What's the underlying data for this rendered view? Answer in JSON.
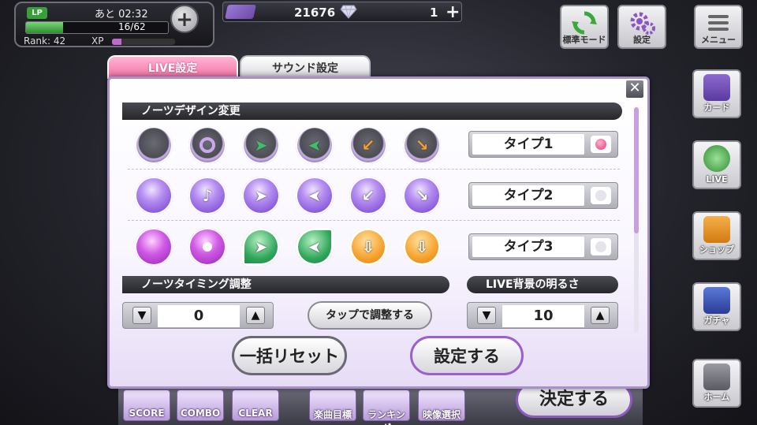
{
  "hud": {
    "lp_badge": "LP",
    "lp_time": "あと 02:32",
    "lp_count": "16/62",
    "lp_fraction": 0.26,
    "rank": "Rank: 42",
    "xp_label": "XP",
    "xp_fraction": 0.15,
    "coins": "21676",
    "gems": "1",
    "plus": "+"
  },
  "top_buttons": {
    "mode_label": "標準モード",
    "settings_label": "設定",
    "menu_label": "メニュー"
  },
  "side_nav": {
    "card": "カード",
    "live": "LIVE",
    "shop": "ショップ",
    "gacha": "ガチャ",
    "home": "ホーム"
  },
  "bottom": {
    "score": "SCORE",
    "combo": "COMBO",
    "clear": "CLEAR",
    "target": "楽曲目標",
    "ranking": "ランキング",
    "video": "映像選択",
    "decide": "決定する"
  },
  "tabs": {
    "live": "LIVE設定",
    "sound": "サウンド設定"
  },
  "close": "✕",
  "sections": {
    "note_design": "ノーツデザイン変更",
    "timing": "ノーツタイミング調整",
    "brightness": "LIVE背景の明るさ"
  },
  "types": [
    {
      "label": "タイプ1",
      "selected": true
    },
    {
      "label": "タイプ2",
      "selected": false
    },
    {
      "label": "タイプ3",
      "selected": false
    }
  ],
  "timing_value": "0",
  "brightness_value": "10",
  "tap_adjust": "タップで調整する",
  "reset_all": "一括リセット",
  "apply": "設定する",
  "colors": {
    "accent_pink": "#f26fa5",
    "accent_purple": "#9a60d0"
  }
}
